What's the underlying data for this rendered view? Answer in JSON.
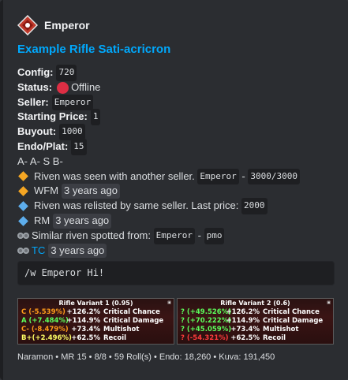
{
  "author": {
    "name": "Emperor"
  },
  "title": "Example Rifle Sati-acricron",
  "fields": {
    "config_label": "Config:",
    "config_value": "720",
    "status_label": "Status:",
    "status_value": "Offline",
    "seller_label": "Seller:",
    "seller_value": "Emperor",
    "starting_label": "Starting Price:",
    "starting_value": "1",
    "buyout_label": "Buyout:",
    "buyout_value": "1000",
    "endo_label": "Endo/Plat:",
    "endo_value": "15"
  },
  "grades": "A- A- S B-",
  "notes": {
    "seen_text": "Riven was seen with another seller.",
    "seen_seller": "Emperor",
    "seen_sep": "-",
    "seen_price": "3000/3000",
    "wfm_label": "WFM",
    "wfm_time": "3 years ago",
    "relisted_text": "Riven was relisted by same seller. Last price:",
    "relisted_price": "2000",
    "rm_label": "RM",
    "rm_time": "3 years ago",
    "similar_text": "Similar riven spotted from:",
    "similar_seller": "Emperor",
    "similar_sep": "-",
    "similar_platform": "pmo",
    "tc_label": "TC",
    "tc_time": "3 years ago"
  },
  "command": "/w Emperor Hi!",
  "cards": [
    {
      "title": "Rifle Variant 1 (0.95)",
      "rows": [
        {
          "grade": "C (-5.539%)",
          "grade_color": "#ff9c1a",
          "value": "+126.2%",
          "name": "Critical Chance"
        },
        {
          "grade": "A (+7.484%)",
          "grade_color": "#5cff5c",
          "value": "+114.9%",
          "name": "Critical Damage"
        },
        {
          "grade": "C- (-8.479%)",
          "grade_color": "#ff9c1a",
          "value": "+73.4%",
          "name": "Multishot"
        },
        {
          "grade": "B+(+2.496%)",
          "grade_color": "#ffff66",
          "value": "+62.5%",
          "name": "Recoil"
        }
      ]
    },
    {
      "title": "Rifle Variant 2 (0.6)",
      "rows": [
        {
          "grade": "? (+49.526%)",
          "grade_color": "#5cff5c",
          "value": "+126.2%",
          "name": "Critical Chance"
        },
        {
          "grade": "? (+70.222%)",
          "grade_color": "#5cff5c",
          "value": "+114.9%",
          "name": "Critical Damage"
        },
        {
          "grade": "? (+45.059%)",
          "grade_color": "#5cff5c",
          "value": "+73.4%",
          "name": "Multishot"
        },
        {
          "grade": "? (-54.321%)",
          "grade_color": "#ff3b3b",
          "value": "+62.5%",
          "name": "Recoil"
        }
      ]
    }
  ],
  "footer": "Naramon • MR 15 • 8/8 • 59 Roll(s) • Endo: 18,260 • Kuva: 191,450",
  "colors": {
    "link": "#00a8fc",
    "accent_border": "#1e1f22",
    "offline": "#dd2e44"
  }
}
